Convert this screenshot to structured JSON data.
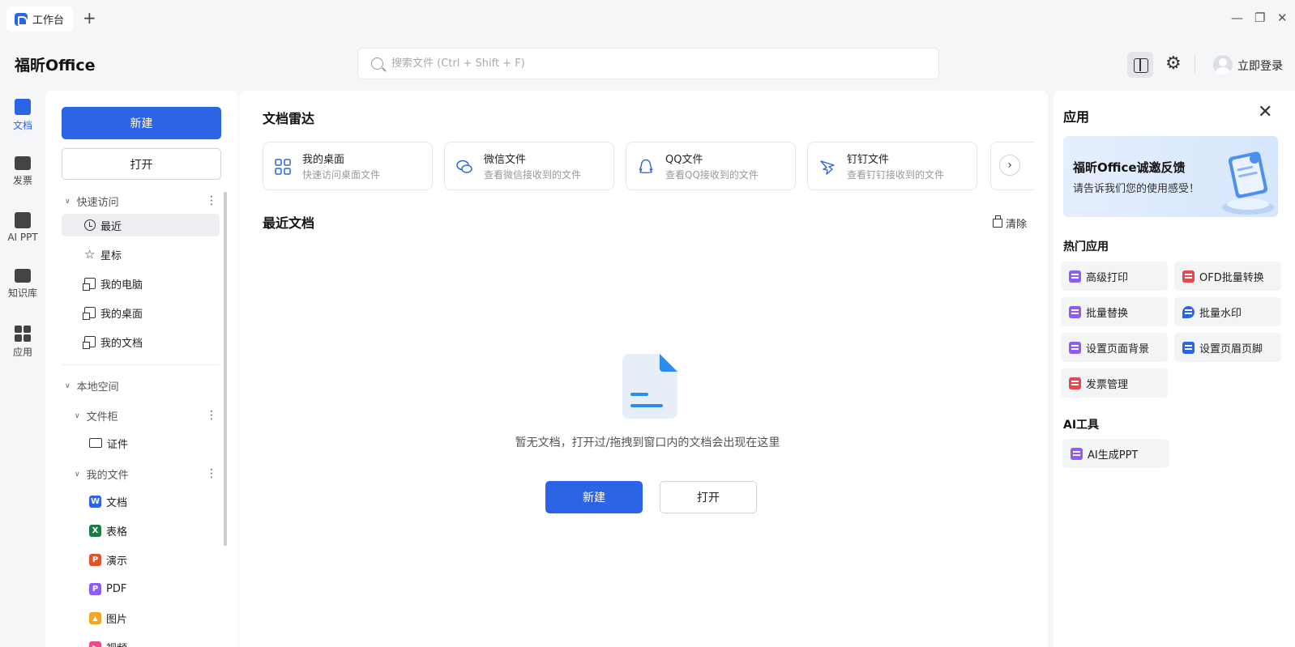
{
  "titlebar": {
    "tab_label": "工作台",
    "new_tab": "+",
    "minimize": "—",
    "restore": "❐",
    "close": "✕"
  },
  "header": {
    "brand": "福昕Office",
    "search_placeholder": "搜索文件 (Ctrl + Shift + F)",
    "login": "立即登录"
  },
  "rail": {
    "items": [
      {
        "label": "文档",
        "icon": "document-icon",
        "active": true
      },
      {
        "label": "发票",
        "icon": "invoice-icon"
      },
      {
        "label": "AI PPT",
        "icon": "ai-ppt-icon"
      },
      {
        "label": "知识库",
        "icon": "book-icon"
      },
      {
        "label": "应用",
        "icon": "apps-grid-icon"
      }
    ]
  },
  "sidebar": {
    "new_button": "新建",
    "open_button": "打开",
    "quick_access": {
      "title": "快速访问",
      "items": [
        "最近",
        "星标",
        "我的电脑",
        "我的桌面",
        "我的文档"
      ]
    },
    "local_space": {
      "title": "本地空间",
      "cabinet": {
        "title": "文件柜",
        "items": [
          "证件"
        ]
      },
      "my_files": {
        "title": "我的文件",
        "items": [
          {
            "label": "文档",
            "badge": "W",
            "color": "#2b65e6"
          },
          {
            "label": "表格",
            "badge": "X",
            "color": "#1d7a45"
          },
          {
            "label": "演示",
            "badge": "P",
            "color": "#e0542b"
          },
          {
            "label": "PDF",
            "badge": "P",
            "color": "#8b5cf6"
          },
          {
            "label": "图片",
            "badge": "▲",
            "color": "#f4a623"
          },
          {
            "label": "视频",
            "badge": "▶",
            "color": "#ec4c8b"
          }
        ]
      }
    }
  },
  "main": {
    "radar_title": "文档雷达",
    "radar_cards": [
      {
        "title": "我的桌面",
        "subtitle": "快速访问桌面文件",
        "icon": "grid-icon"
      },
      {
        "title": "微信文件",
        "subtitle": "查看微信接收到的文件",
        "icon": "wechat-icon"
      },
      {
        "title": "QQ文件",
        "subtitle": "查看QQ接收到的文件",
        "icon": "qq-icon"
      },
      {
        "title": "钉钉文件",
        "subtitle": "查看钉钉接收到的文件",
        "icon": "dingtalk-icon"
      }
    ],
    "recent_title": "最近文档",
    "clear_label": "清除",
    "empty_text": "暂无文档，打开过/拖拽到窗口内的文档会出现在这里",
    "new_button": "新建",
    "open_button": "打开"
  },
  "apps": {
    "title": "应用",
    "banner_title": "福昕Office诚邀反馈",
    "banner_subtitle": "请告诉我们您的使用感受！",
    "hot_title": "热门应用",
    "hot": [
      {
        "label": "高级打印",
        "color": "#8b5cf6"
      },
      {
        "label": "OFD批量转换",
        "color": "#e5484d"
      },
      {
        "label": "批量替换",
        "color": "#8b5cf6"
      },
      {
        "label": "批量水印",
        "color": "#2b65e6"
      },
      {
        "label": "设置页面背景",
        "color": "#8b5cf6"
      },
      {
        "label": "设置页眉页脚",
        "color": "#2b65e6"
      },
      {
        "label": "发票管理",
        "color": "#e5484d"
      }
    ],
    "ai_title": "AI工具",
    "ai": [
      {
        "label": "AI生成PPT",
        "color": "#8b5cf6"
      }
    ]
  },
  "colors": {
    "accent": "#2b65e6",
    "background": "#f5f6f8"
  }
}
